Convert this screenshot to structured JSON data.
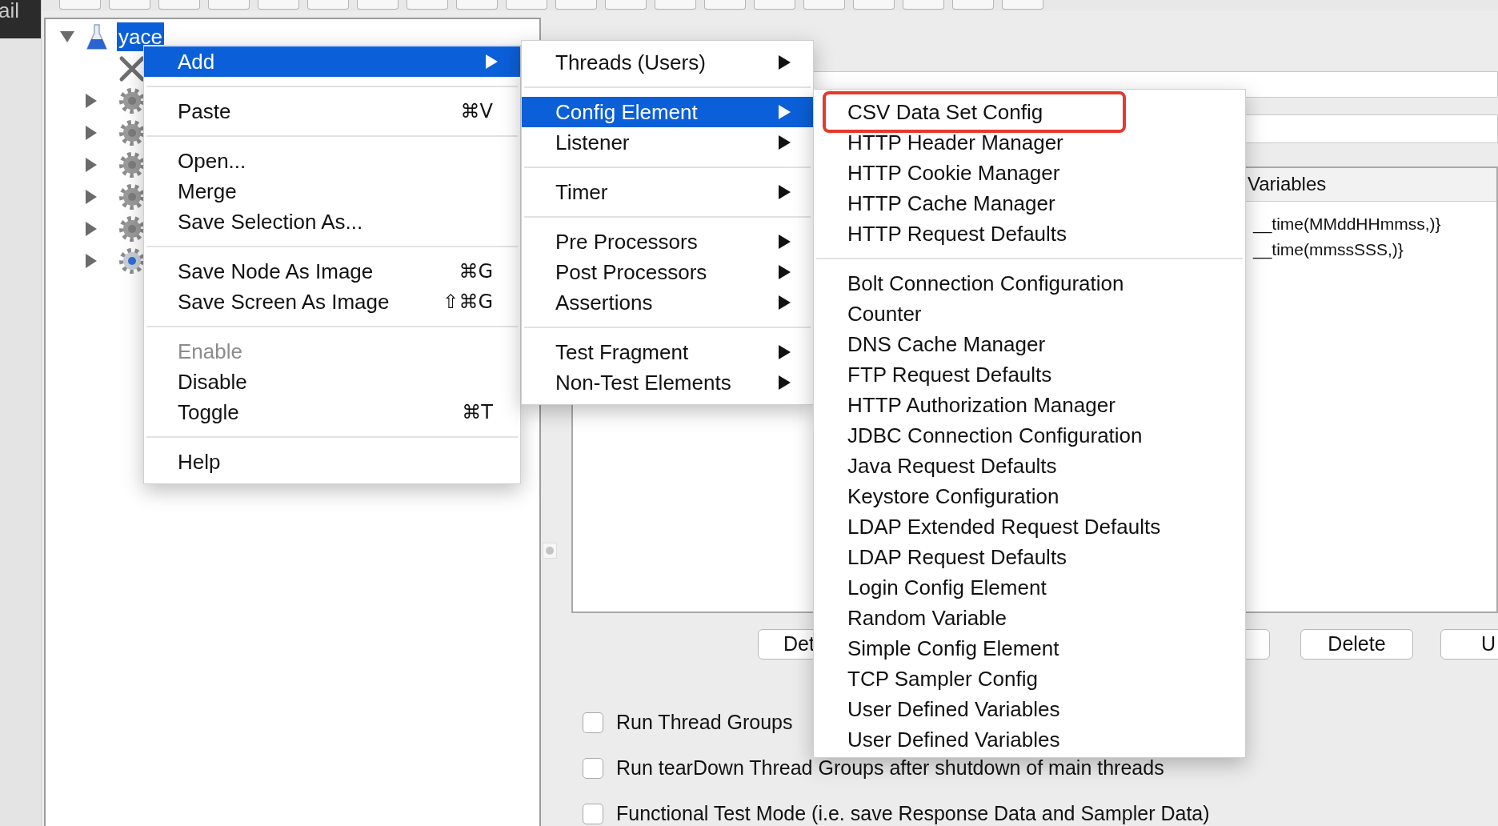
{
  "sidebar_label": "ail",
  "tree": {
    "label": "yace",
    "selected": true,
    "expanded": true,
    "children": [
      {
        "kind": "config"
      },
      {
        "kind": "fragment",
        "expanded": false
      },
      {
        "kind": "fragment",
        "expanded": false
      },
      {
        "kind": "fragment",
        "expanded": false
      },
      {
        "kind": "fragment",
        "expanded": false
      },
      {
        "kind": "fragment",
        "expanded": false
      },
      {
        "kind": "thread-group",
        "expanded": false
      }
    ]
  },
  "context_menu": {
    "items": [
      {
        "kind": "item",
        "label": "Add",
        "submenu": true,
        "selected": true,
        "disabled": false
      },
      {
        "kind": "separator"
      },
      {
        "kind": "item",
        "label": "Paste",
        "shortcut": "⌘V",
        "submenu": false,
        "selected": false,
        "disabled": false
      },
      {
        "kind": "separator"
      },
      {
        "kind": "item",
        "label": "Open...",
        "submenu": false,
        "selected": false,
        "disabled": false
      },
      {
        "kind": "item",
        "label": "Merge",
        "submenu": false,
        "selected": false,
        "disabled": false
      },
      {
        "kind": "item",
        "label": "Save Selection As...",
        "submenu": false,
        "selected": false,
        "disabled": false
      },
      {
        "kind": "separator"
      },
      {
        "kind": "item",
        "label": "Save Node As Image",
        "shortcut": "⌘G",
        "submenu": false,
        "selected": false,
        "disabled": false
      },
      {
        "kind": "item",
        "label": "Save Screen As Image",
        "shortcut": "⇧⌘G",
        "submenu": false,
        "selected": false,
        "disabled": false
      },
      {
        "kind": "separator"
      },
      {
        "kind": "item",
        "label": "Enable",
        "submenu": false,
        "selected": false,
        "disabled": true
      },
      {
        "kind": "item",
        "label": "Disable",
        "submenu": false,
        "selected": false,
        "disabled": false
      },
      {
        "kind": "item",
        "label": "Toggle",
        "shortcut": "⌘T",
        "submenu": false,
        "selected": false,
        "disabled": false
      },
      {
        "kind": "separator"
      },
      {
        "kind": "item",
        "label": "Help",
        "submenu": false,
        "selected": false,
        "disabled": false
      }
    ]
  },
  "add_submenu": {
    "items": [
      {
        "kind": "item",
        "label": "Threads (Users)",
        "submenu": true,
        "selected": false
      },
      {
        "kind": "separator"
      },
      {
        "kind": "item",
        "label": "Config Element",
        "submenu": true,
        "selected": true
      },
      {
        "kind": "item",
        "label": "Listener",
        "submenu": true,
        "selected": false
      },
      {
        "kind": "separator"
      },
      {
        "kind": "item",
        "label": "Timer",
        "submenu": true,
        "selected": false
      },
      {
        "kind": "separator"
      },
      {
        "kind": "item",
        "label": "Pre Processors",
        "submenu": true,
        "selected": false
      },
      {
        "kind": "item",
        "label": "Post Processors",
        "submenu": true,
        "selected": false
      },
      {
        "kind": "item",
        "label": "Assertions",
        "submenu": true,
        "selected": false
      },
      {
        "kind": "separator"
      },
      {
        "kind": "item",
        "label": "Test Fragment",
        "submenu": true,
        "selected": false
      },
      {
        "kind": "item",
        "label": "Non-Test Elements",
        "submenu": true,
        "selected": false
      }
    ]
  },
  "config_submenu": {
    "items": [
      {
        "kind": "item",
        "label": "CSV Data Set Config",
        "circled": true
      },
      {
        "kind": "item",
        "label": "HTTP Header Manager",
        "circled": false
      },
      {
        "kind": "item",
        "label": "HTTP Cookie Manager",
        "circled": false
      },
      {
        "kind": "item",
        "label": "HTTP Cache Manager",
        "circled": false
      },
      {
        "kind": "item",
        "label": "HTTP Request Defaults",
        "circled": false
      },
      {
        "kind": "separator"
      },
      {
        "kind": "item",
        "label": "Bolt Connection Configuration",
        "circled": false
      },
      {
        "kind": "item",
        "label": "Counter",
        "circled": false
      },
      {
        "kind": "item",
        "label": "DNS Cache Manager",
        "circled": false
      },
      {
        "kind": "item",
        "label": "FTP Request Defaults",
        "circled": false
      },
      {
        "kind": "item",
        "label": "HTTP Authorization Manager",
        "circled": false
      },
      {
        "kind": "item",
        "label": "JDBC Connection Configuration",
        "circled": false
      },
      {
        "kind": "item",
        "label": "Java Request Defaults",
        "circled": false
      },
      {
        "kind": "item",
        "label": "Keystore Configuration",
        "circled": false
      },
      {
        "kind": "item",
        "label": "LDAP Extended Request Defaults",
        "circled": false
      },
      {
        "kind": "item",
        "label": "LDAP Request Defaults",
        "circled": false
      },
      {
        "kind": "item",
        "label": "Login Config Element",
        "circled": false
      },
      {
        "kind": "item",
        "label": "Random Variable",
        "circled": false
      },
      {
        "kind": "item",
        "label": "Simple Config Element",
        "circled": false
      },
      {
        "kind": "item",
        "label": "TCP Sampler Config",
        "circled": false
      },
      {
        "kind": "item",
        "label": "User Defined Variables",
        "circled": false
      },
      {
        "kind": "item",
        "label": "User Defined Variables",
        "circled": false
      }
    ]
  },
  "plan_panel": {
    "table_header": "Variables",
    "rows": [
      "__time(MMddHHmmss,)}",
      "__time(mmssSSS,)}"
    ],
    "buttons": [
      {
        "kind": "labeled",
        "label": "Det"
      },
      {
        "kind": "covered"
      },
      {
        "kind": "labeled",
        "label": "Delete"
      },
      {
        "kind": "labeled",
        "label": "U"
      }
    ],
    "options": [
      {
        "label": "Run Thread Groups",
        "checked": false
      },
      {
        "label": "Run tearDown Thread Groups after shutdown of main threads",
        "checked": false
      },
      {
        "label": "Functional Test Mode (i.e. save Response Data and Sampler Data)",
        "checked": false
      }
    ]
  }
}
